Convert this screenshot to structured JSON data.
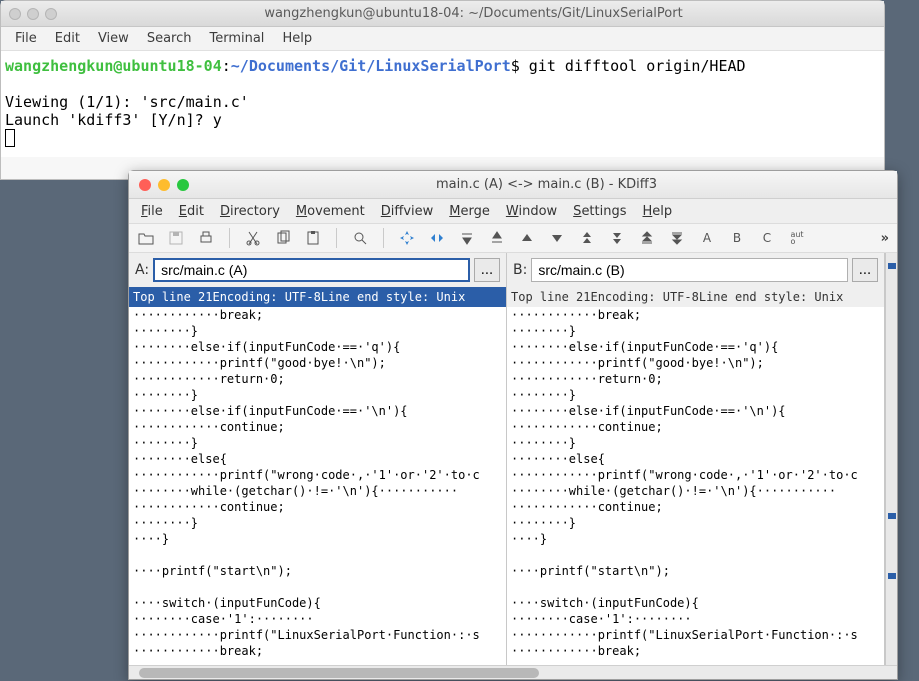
{
  "terminal": {
    "title": "wangzhengkun@ubuntu18-04: ~/Documents/Git/LinuxSerialPort",
    "menu": [
      "File",
      "Edit",
      "View",
      "Search",
      "Terminal",
      "Help"
    ],
    "prompt_user": "wangzhengkun@ubuntu18-04",
    "prompt_sep": ":",
    "prompt_path": "~/Documents/Git/LinuxSerialPort",
    "prompt_dollar": "$",
    "command": " git difftool origin/HEAD",
    "line2": "Viewing (1/1): 'src/main.c'",
    "line3": "Launch 'kdiff3' [Y/n]? y"
  },
  "kdiff": {
    "title": "main.c (A) <-> main.c (B) - KDiff3",
    "menu": [
      "File",
      "Edit",
      "Directory",
      "Movement",
      "Diffview",
      "Merge",
      "Window",
      "Settings",
      "Help"
    ],
    "toolbar_letters": {
      "a": "A",
      "b": "B",
      "c": "C",
      "auto": "aut\no"
    },
    "left": {
      "label": "A:",
      "path": "src/main.c (A)",
      "info": "Top line 21Encoding: UTF-8Line end style: Unix"
    },
    "right": {
      "label": "B:",
      "path": "src/main.c (B)",
      "info": "Top line 21Encoding: UTF-8Line end style: Unix"
    },
    "browse": "...",
    "code": "············break;\n········}\n········else·if(inputFunCode·==·'q'){\n············printf(\"good·bye!·\\n\");\n············return·0;\n········}\n········else·if(inputFunCode·==·'\\n'){\n············continue;\n········}\n········else{\n············printf(\"wrong·code·,·'1'·or·'2'·to·c\n········while·(getchar()·!=·'\\n'){···········\n············continue;\n········}\n····}\n\n····printf(\"start\\n\");\n\n····switch·(inputFunCode){\n········case·'1':········\n············printf(\"LinuxSerialPort·Function·:·s\n············break;"
  }
}
